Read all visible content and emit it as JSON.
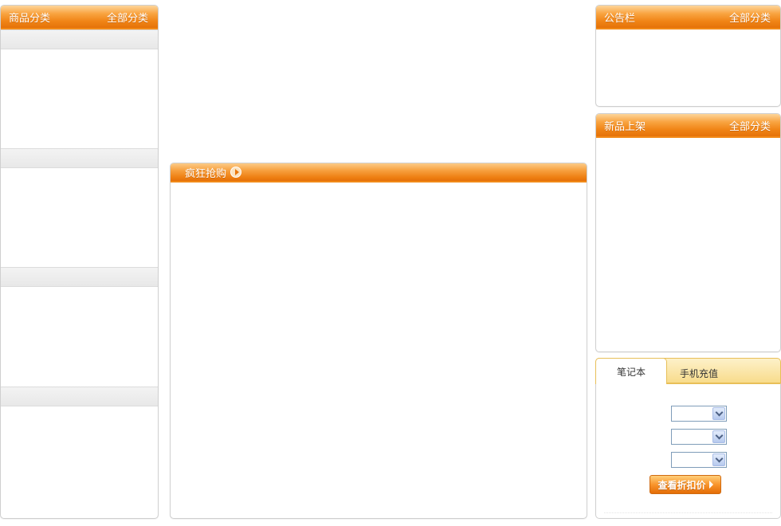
{
  "category_panel": {
    "title": "商品分类",
    "more_link": "全部分类"
  },
  "flash_sale": {
    "title": "疯狂抢购",
    "arrow_icon": "arrow-right-circle-icon"
  },
  "notice_panel": {
    "title": "公告栏",
    "more_link": "全部分类"
  },
  "new_arrivals_panel": {
    "title": "新品上架",
    "more_link": "全部分类"
  },
  "price_tabs": {
    "tabs": [
      {
        "label": "笔记本",
        "active": true
      },
      {
        "label": "手机充值",
        "active": false
      }
    ],
    "selects": [
      {
        "selected": ""
      },
      {
        "selected": ""
      },
      {
        "selected": ""
      }
    ],
    "submit_label": "查看折扣价"
  },
  "colors": {
    "header_orange": "#f08416",
    "tab_yellow": "#f8dc8c",
    "border_gray": "#cfcfcf"
  }
}
